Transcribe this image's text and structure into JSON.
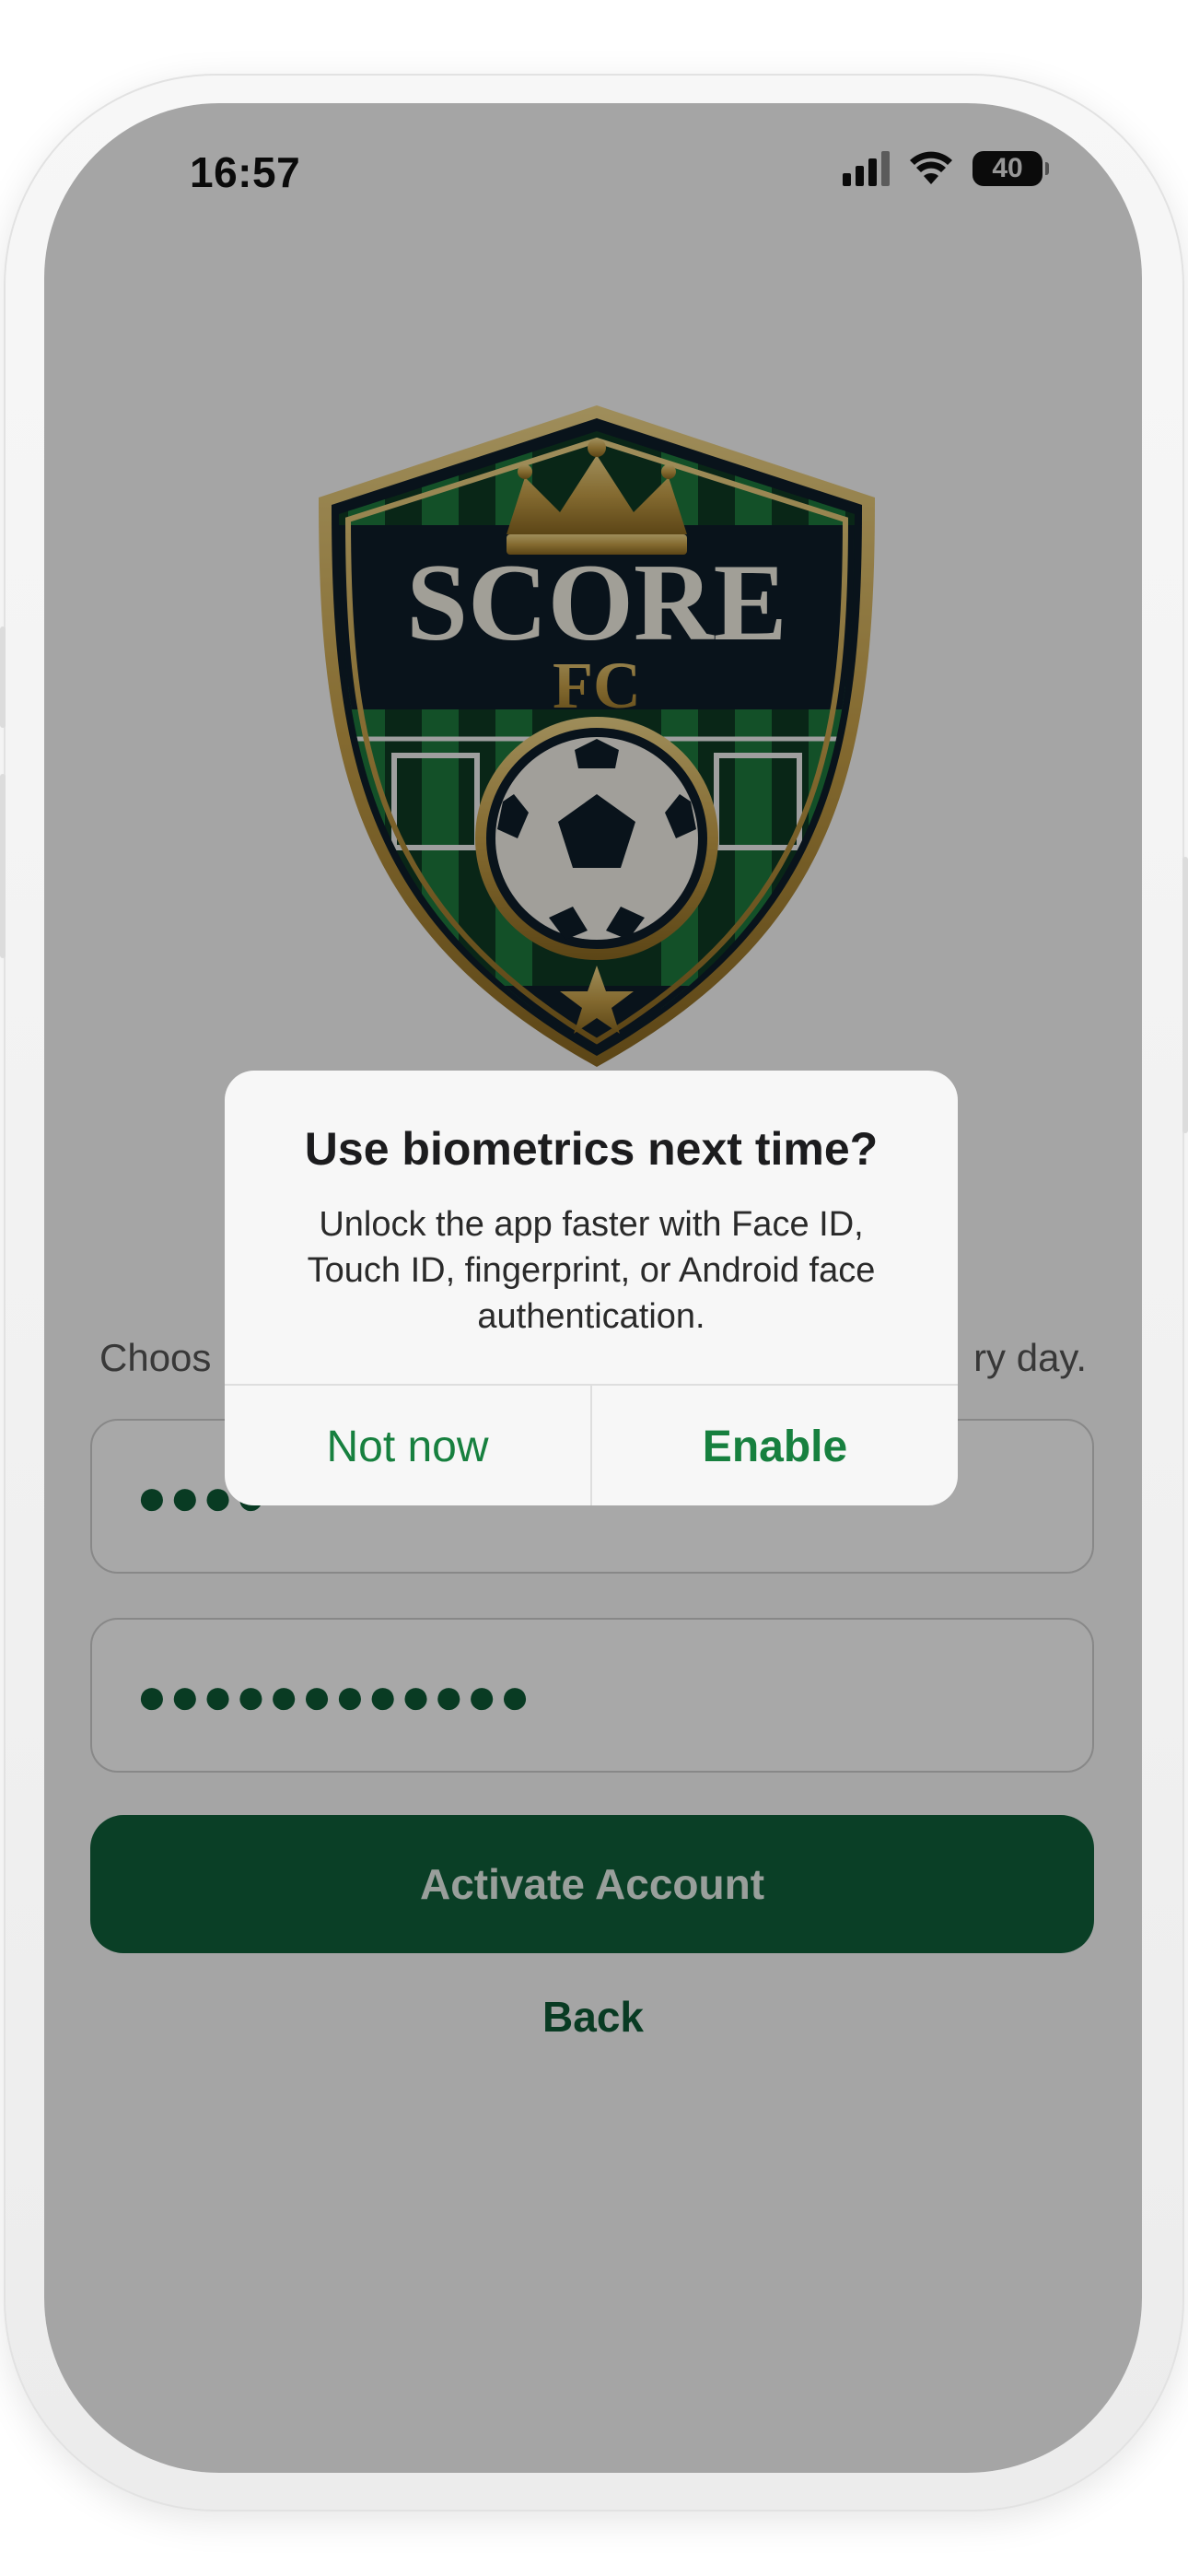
{
  "status_bar": {
    "time": "16:57",
    "battery": "40",
    "signal_icon": "cellular-signal-icon",
    "wifi_icon": "wifi-icon"
  },
  "logo": {
    "name": "SCORE",
    "suffix": "FC"
  },
  "form": {
    "subtitle_left": "Choos",
    "subtitle_right": "ry day.",
    "password_mask": "●●●●",
    "confirm_mask": "●●●●●●●●●●●●",
    "activate_label": "Activate Account",
    "back_label": "Back"
  },
  "dialog": {
    "title": "Use biometrics next time?",
    "message": "Unlock the app faster with Face ID, Touch ID, fingerprint, or Android face authentication.",
    "secondary_label": "Not now",
    "primary_label": "Enable"
  },
  "colors": {
    "brand_green": "#10603a",
    "action_green": "#17803f",
    "crest_navy": "#0e1d2a",
    "crest_gold": "#c9a24a"
  }
}
